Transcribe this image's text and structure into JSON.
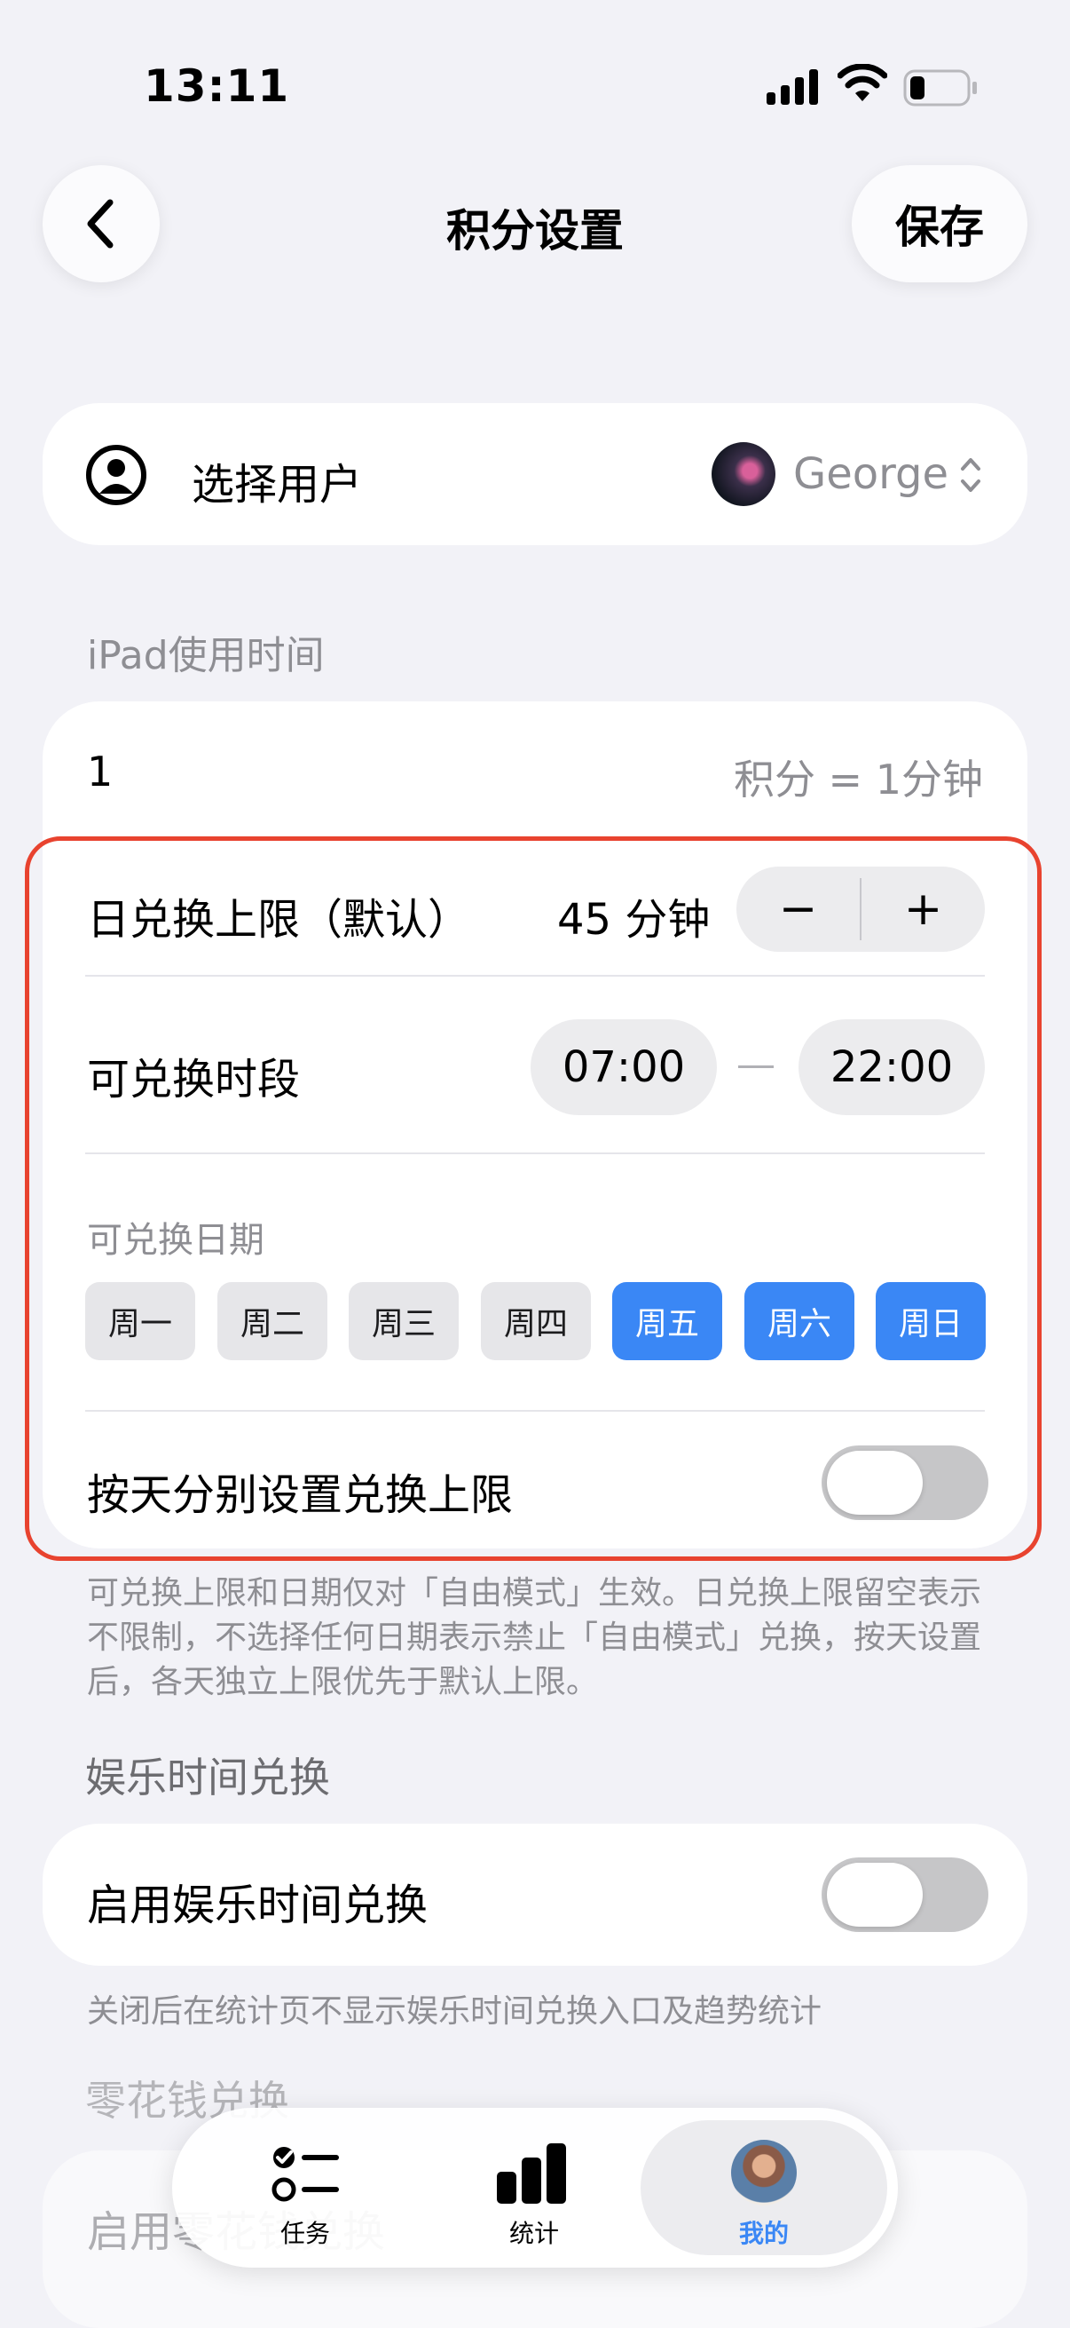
{
  "status_bar": {
    "time": "13:11"
  },
  "nav": {
    "title": "积分设置",
    "save_label": "保存"
  },
  "user": {
    "label": "选择用户",
    "value": "George"
  },
  "ipad": {
    "section_title": "iPad使用时间",
    "rate_value": "1",
    "rate_unit": "积分 = 1分钟",
    "daily_limit_label": "日兑换上限（默认）",
    "daily_limit_value": "45 分钟",
    "minus_label": "−",
    "plus_label": "+",
    "period_label": "可兑换时段",
    "period_start": "07:00",
    "period_end": "22:00",
    "dates_label": "可兑换日期",
    "days": [
      {
        "label": "周一",
        "selected": false
      },
      {
        "label": "周二",
        "selected": false
      },
      {
        "label": "周三",
        "selected": false
      },
      {
        "label": "周四",
        "selected": false
      },
      {
        "label": "周五",
        "selected": true
      },
      {
        "label": "周六",
        "selected": true
      },
      {
        "label": "周日",
        "selected": true
      }
    ],
    "per_day_label": "按天分别设置兑换上限",
    "per_day_enabled": false,
    "footnote": "可兑换上限和日期仅对「自由模式」生效。日兑换上限留空表示不限制，不选择任何日期表示禁止「自由模式」兑换，按天设置后，各天独立上限优先于默认上限。"
  },
  "entertainment": {
    "section_title": "娱乐时间兑换",
    "toggle_label": "启用娱乐时间兑换",
    "enabled": false,
    "note": "关闭后在统计页不显示娱乐时间兑换入口及趋势统计"
  },
  "pocket_money": {
    "section_title": "零花钱兑换",
    "toggle_label": "启用零花钱兑换"
  },
  "tabbar": {
    "tabs": [
      {
        "label": "任务",
        "active": false
      },
      {
        "label": "统计",
        "active": false
      },
      {
        "label": "我的",
        "active": true
      }
    ]
  },
  "colors": {
    "accent": "#3a87f5",
    "highlight_border": "#e8432f",
    "background": "#f2f2f7",
    "secondary_text": "#8e8e93"
  }
}
